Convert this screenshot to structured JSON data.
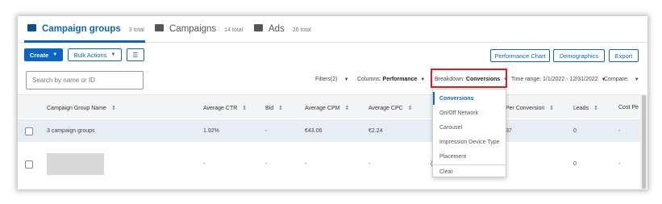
{
  "tabs": [
    {
      "label": "Campaign groups",
      "count": "3 total",
      "icon": "folder-icon",
      "active": true
    },
    {
      "label": "Campaigns",
      "count": "14 total",
      "icon": "campaign-icon",
      "active": false
    },
    {
      "label": "Ads",
      "count": "26 total",
      "icon": "ad-icon",
      "active": false
    }
  ],
  "toolbar": {
    "create_label": "Create",
    "bulk_actions_label": "Bulk Actions",
    "performance_chart_label": "Performance Chart",
    "demographics_label": "Demographics",
    "export_label": "Export"
  },
  "search": {
    "placeholder": "Search by name or ID"
  },
  "controls": {
    "filters_label": "Filters(2)",
    "columns_prefix": "Columns:",
    "columns_value": "Performance",
    "breakdown_prefix": "Breakdown:",
    "breakdown_value": "Conversions",
    "time_range_label": "Time range: 1/1/2022 - 12/31/2022",
    "compare_label": "Compare:"
  },
  "table": {
    "headers": [
      "Campaign Group Name",
      "Average CTR",
      "Bid",
      "Average CPM",
      "Average CPC",
      "Per Conversion",
      "Leads",
      "Cost Pe"
    ],
    "rows": [
      {
        "name": "3 campaign groups",
        "ctr": "1.92%",
        "bid": "-",
        "cpm": "€43.06",
        "cpc": "€2.24",
        "conversion": "37",
        "leads": "0",
        "cost": "-"
      },
      {
        "name": "",
        "ctr": "-",
        "bid": "-",
        "cpm": "-",
        "cpc": "-",
        "conversion": "(",
        "leads": "0",
        "cost": "-"
      }
    ]
  },
  "breakdown_menu": {
    "items": [
      "Conversions",
      "On/Off Network",
      "Carousel",
      "Impression Device Type",
      "Placement"
    ],
    "selected": "Conversions",
    "clear_label": "Clear"
  },
  "colors": {
    "accent": "#0a66c2",
    "highlight": "#e01b1b",
    "row_highlight": "#e8edf3"
  }
}
